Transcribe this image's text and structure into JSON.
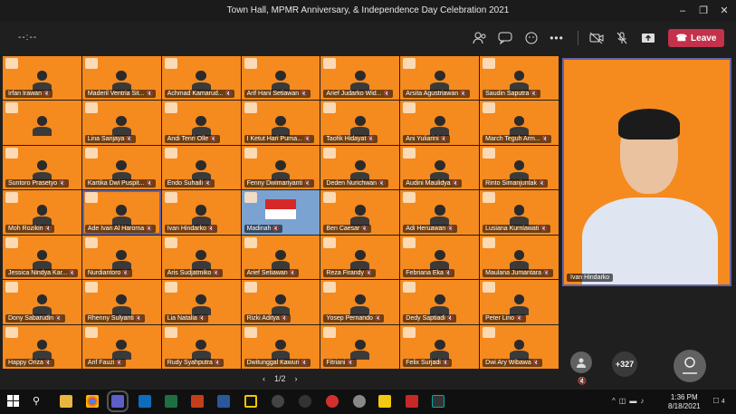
{
  "window": {
    "title": "Town Hall, MPMR Anniversary, & Independence Day Celebration 2021"
  },
  "toolbar": {
    "timer": "--:--",
    "leave_label": "Leave"
  },
  "grid": {
    "tiles": [
      {
        "name": "Irfan Irawan"
      },
      {
        "name": "Maderil Ventria Sit..."
      },
      {
        "name": "Achmad  Kamarud..."
      },
      {
        "name": "Arif Hani Setiawan"
      },
      {
        "name": "Arief Judarko Wid..."
      },
      {
        "name": "Arsita Agustriawan"
      },
      {
        "name": "Saudin Saputra"
      },
      {
        "name": ""
      },
      {
        "name": "Lina Sanjaya"
      },
      {
        "name": "Andi Tenri Olle"
      },
      {
        "name": "I Ketut Hari Purna..."
      },
      {
        "name": "Taofik Hidayat"
      },
      {
        "name": "Ani Yuliarini"
      },
      {
        "name": "March Teguh Arm..."
      },
      {
        "name": "Suntoro Prasetyo"
      },
      {
        "name": "Kartika Dwi Puspit..."
      },
      {
        "name": "Endo Suhaili"
      },
      {
        "name": "Fenny Dwimariyanti"
      },
      {
        "name": "Deden Nurichwan"
      },
      {
        "name": "Audini Maulidya"
      },
      {
        "name": "Rinto Simanjuntak"
      },
      {
        "name": "Moh Rozikin"
      },
      {
        "name": "Ade Ivan Al Haroma"
      },
      {
        "name": "Ivan Hindarko"
      },
      {
        "name": "Madinah"
      },
      {
        "name": "Ben Caesar"
      },
      {
        "name": "Adi Heruawan"
      },
      {
        "name": "Lusiana Kurniawati"
      },
      {
        "name": "Jessica Nindya Kar..."
      },
      {
        "name": "Nurdiantoro"
      },
      {
        "name": "Aris Sudjatmiko"
      },
      {
        "name": "Arief Setiawan"
      },
      {
        "name": "Reza Firandy"
      },
      {
        "name": "Febriana Eka"
      },
      {
        "name": "Maulana Jumantara"
      },
      {
        "name": "Dony Sabarudin"
      },
      {
        "name": "Rhenny Sulyanti"
      },
      {
        "name": "Lia Natalia"
      },
      {
        "name": "Rizki Aditya"
      },
      {
        "name": "Yosep Pernando"
      },
      {
        "name": "Dedy Saptiadi"
      },
      {
        "name": "Peter Lino"
      },
      {
        "name": "Happy Oriza"
      },
      {
        "name": "Arif Fauzi"
      },
      {
        "name": "Rudy Syahputra"
      },
      {
        "name": "Dwitunggal Kawuri"
      },
      {
        "name": "Fitriani"
      },
      {
        "name": "Felix Surjadi"
      },
      {
        "name": "Dwi Ary Wibawa"
      }
    ]
  },
  "pager": {
    "label": "1/2",
    "prev": "‹",
    "next": "›"
  },
  "spotlight": {
    "name": "Ivan Hindarko"
  },
  "overflow": {
    "count": "+327"
  },
  "taskbar": {
    "time": "1:36 PM",
    "date": "8/18/2021",
    "notifications": "4"
  }
}
